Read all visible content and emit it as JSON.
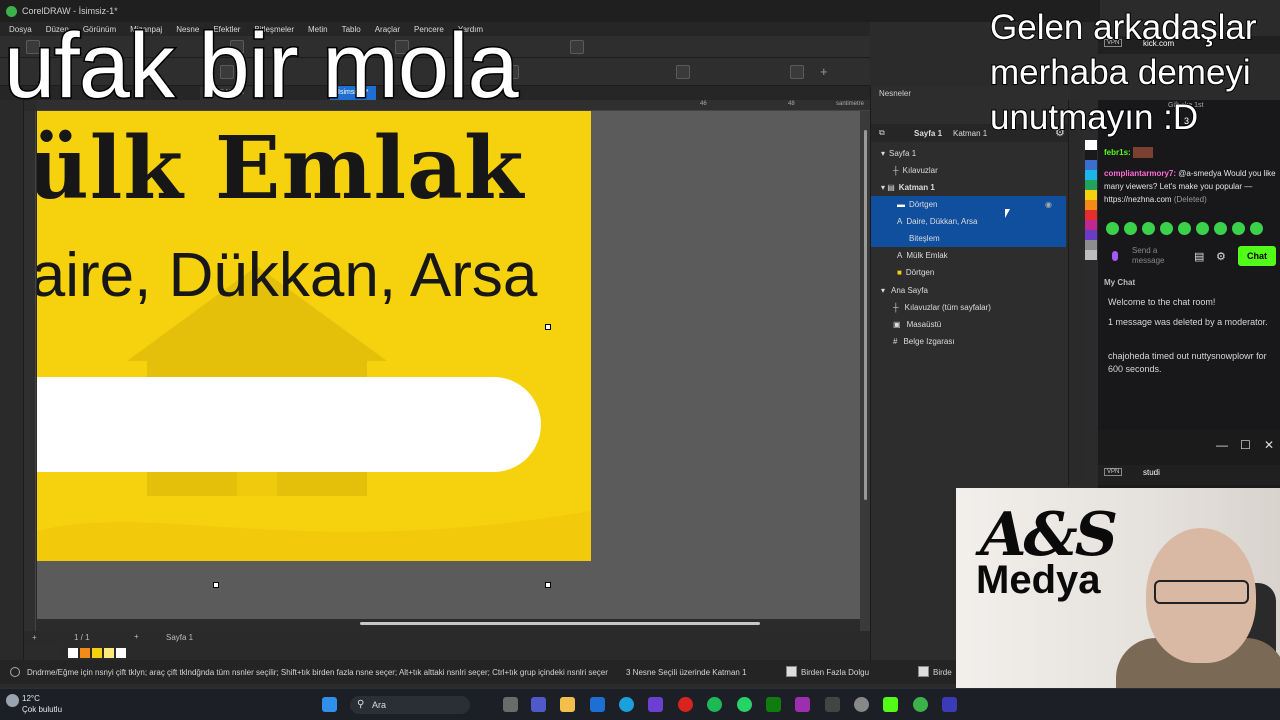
{
  "window": {
    "title": "CorelDRAW - İsimsiz-1*"
  },
  "menu": [
    "Dosya",
    "Düzen",
    "Görünüm",
    "Mizanpaj",
    "Nesne",
    "Efektler",
    "Bitleşmeler",
    "Metin",
    "Tablo",
    "Araçlar",
    "Pencere",
    "Yardım"
  ],
  "tabs": {
    "branda": "X BRANDA",
    "doc": "İsimsiz-1*"
  },
  "ruler_unit": "santimetre",
  "ruler_marks": [
    "46",
    "48"
  ],
  "canvas": {
    "title_text": "Mülk Emlak",
    "subtitle_text": "Daire, Dükkan, Arsa"
  },
  "pagebar": {
    "counter": "1 / 1",
    "page_tab": "Sayfa 1"
  },
  "status": {
    "hint": "Dndrme/Eğme için nsnyi çift tklyn; araç çift tklndğnda tüm nsnler seçilir; Shift+tık birden fazla nsne seçer; Alt+tık alttaki nsnlri seçer; Ctrl+tık grup içindeki nsnlri seçer",
    "selection": "3 Nesne Seçili üzerinde Katman 1",
    "fill": "Birden Fazla Dolgu",
    "fill2": "Birde"
  },
  "docker": {
    "title": "Nesneler",
    "page_label": "Sayfa 1",
    "layer_label": "Katman 1",
    "rows": [
      {
        "label": "Sayfa 1",
        "indent": 0
      },
      {
        "label": "Kılavuzlar",
        "indent": 1
      },
      {
        "label": "Katman 1",
        "indent": 0
      },
      {
        "label": "Dörtgen",
        "indent": 2
      },
      {
        "label": "Daire, Dükkan, Arsa",
        "indent": 2
      },
      {
        "label": "Biteşlem",
        "indent": 3
      },
      {
        "label": "Mülk Emlak",
        "indent": 2
      },
      {
        "label": "Dörtgen",
        "indent": 2
      },
      {
        "label": "Ana Sayfa",
        "indent": 0
      },
      {
        "label": "Kılavuzlar (tüm sayfalar)",
        "indent": 1
      },
      {
        "label": "Masaüstü",
        "indent": 1
      },
      {
        "label": "Belge Izgarası",
        "indent": 1
      }
    ]
  },
  "overlay": {
    "big": "ufak bir mola",
    "right_lines": [
      "Gelen arkadaşlar",
      "merhaba demeyi",
      "unutmayın :D"
    ]
  },
  "chat": {
    "vpn": "VPN",
    "url": "kick.com",
    "gift_line": "Gift   ake 1st",
    "count": "3",
    "msg1_user": "febr1s:",
    "msg2_user": "compliantarmory7:",
    "msg2_text": "@a-smedya Would you like many viewers? Let's make you popular — https://nezhna.com",
    "msg2_deleted": "(Deleted)",
    "send_placeholder": "Send a message",
    "chat_button": "Chat",
    "my_chat": "My Chat",
    "system": [
      "Welcome to the chat room!",
      "1 message was deleted by a moderator.",
      "chajoheda timed out nuttysnowplowr for 600 seconds."
    ]
  },
  "window2": {
    "url": "studi"
  },
  "webcam": {
    "logo_top": "A&S",
    "logo_bottom": "Medya"
  },
  "taskbar": {
    "temp": "12°C",
    "weather": "Çok bulutlu",
    "search": "Ara"
  },
  "colors": {
    "page_yellow": "#f6d10d",
    "selection_blue": "#0f4f9e",
    "kick_green": "#53fc18"
  }
}
